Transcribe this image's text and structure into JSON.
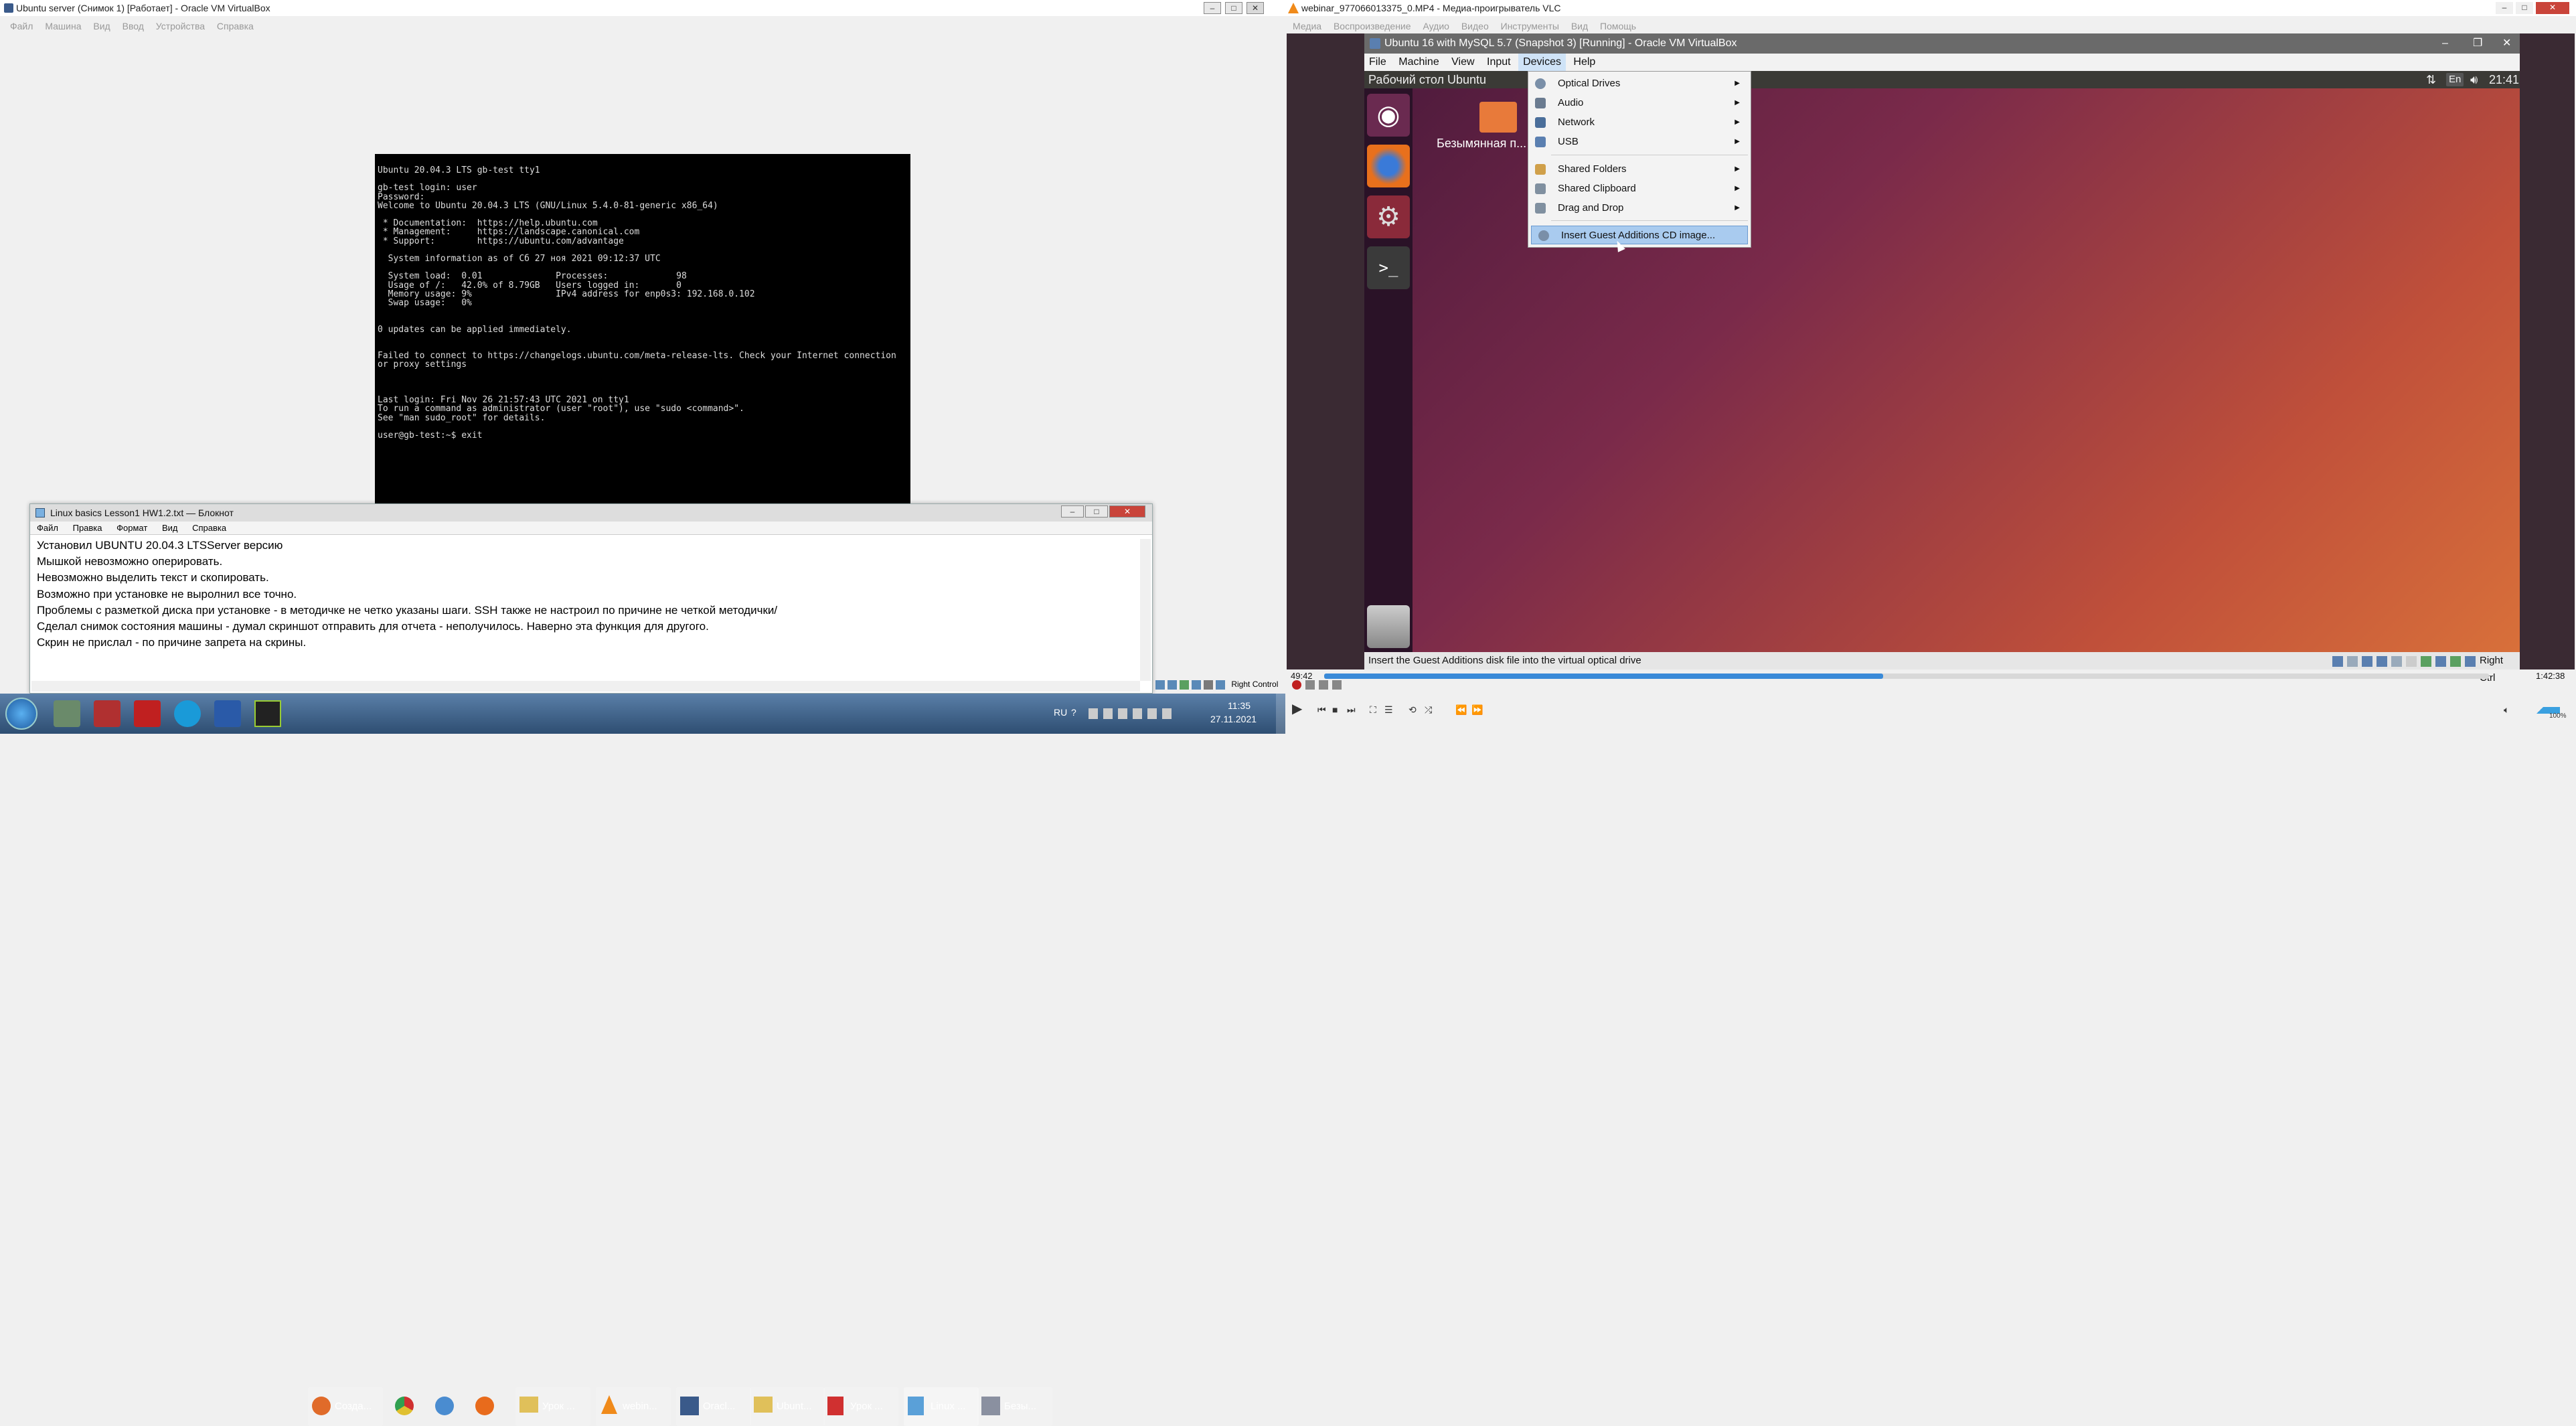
{
  "left_window": {
    "title": "Ubuntu server (Снимок 1) [Работает] - Oracle VM VirtualBox",
    "menu": [
      "Файл",
      "Машина",
      "Вид",
      "Ввод",
      "Устройства",
      "Справка"
    ],
    "status_right": "Right Control"
  },
  "terminal": {
    "lines": "Ubuntu 20.04.3 LTS gb-test tty1\n\ngb-test login: user\nPassword:\nWelcome to Ubuntu 20.04.3 LTS (GNU/Linux 5.4.0-81-generic x86_64)\n\n * Documentation:  https://help.ubuntu.com\n * Management:     https://landscape.canonical.com\n * Support:        https://ubuntu.com/advantage\n\n  System information as of Сб 27 ноя 2021 09:12:37 UTC\n\n  System load:  0.01              Processes:             98\n  Usage of /:   42.0% of 8.79GB   Users logged in:       0\n  Memory usage: 9%                IPv4 address for enp0s3: 192.168.0.102\n  Swap usage:   0%\n\n\n0 updates can be applied immediately.\n\n\nFailed to connect to https://changelogs.ubuntu.com/meta-release-lts. Check your Internet connection\nor proxy settings\n\n\n\nLast login: Fri Nov 26 21:57:43 UTC 2021 on tty1\nTo run a command as administrator (user \"root\"), use \"sudo <command>\".\nSee \"man sudo_root\" for details.\n\nuser@gb-test:~$ exit"
  },
  "notepad": {
    "title": "Linux basics Lesson1 HW1.2.txt — Блокнот",
    "menu": [
      "Файл",
      "Правка",
      "Формат",
      "Вид",
      "Справка"
    ],
    "lines": [
      "Установил UBUNTU 20.04.3 LTSServer версию",
      "Мышкой невозможно оперировать.",
      "Невозможно выделить текст и скопировать.",
      "Возможно при установке не выролнил все точно.",
      "Проблемы с разметкой диска при установке - в методичке не четко указаны шаги. SSH также не настроил по причине не четкой методички/",
      "Сделал снимок состояния машины - думал скриншот отправить для отчета - неполучилось. Наверно эта функция для другого.",
      "Скрин не прислал - по причине запрета на скрины."
    ]
  },
  "vlc": {
    "title": "webinar_977066013...",
    "title_full": "webinar_977066013375_0.MP4 - Медиа-проигрыватель VLC",
    "menu": [
      "Медиа",
      "Воспроизведение",
      "Аудио",
      "Видео",
      "Инструменты",
      "Вид",
      "Помощь"
    ],
    "time_elapsed": "49:42",
    "time_total": "1:42:38",
    "progress": 0.48,
    "volume": "100%"
  },
  "inner_vbox": {
    "title": "Ubuntu 16 with MySQL 5.7 (Snapshot 3) [Running] - Oracle VM VirtualBox",
    "menu": [
      "File",
      "Machine",
      "View",
      "Input",
      "Devices",
      "Help"
    ],
    "active_menu": "Devices",
    "status_text": "Insert the Guest Additions disk file into the virtual optical drive",
    "status_right": "Right Ctrl"
  },
  "ubuntu": {
    "topbar_title": "Рабочий стол Ubuntu",
    "lang": "En",
    "clock": "21:41",
    "desktop_folder": "Безымянная п..."
  },
  "devices_menu": {
    "items": [
      {
        "label": "Optical Drives",
        "submenu": true,
        "icon_color": "#7a8fa8"
      },
      {
        "label": "Audio",
        "submenu": true,
        "icon_color": "#6a7b90"
      },
      {
        "label": "Network",
        "submenu": true,
        "icon_color": "#4a6e9a"
      },
      {
        "label": "USB",
        "submenu": true,
        "icon_color": "#5a7fb0"
      },
      {
        "label": "Shared Folders",
        "submenu": true,
        "icon_color": "#d0a04a"
      },
      {
        "label": "Shared Clipboard",
        "submenu": true,
        "icon_color": "#8090a0"
      },
      {
        "label": "Drag and Drop",
        "submenu": true,
        "icon_color": "#8090a0"
      },
      {
        "label": "Insert Guest Additions CD image...",
        "submenu": false,
        "highlighted": true,
        "icon_color": "#7a8fa8"
      }
    ]
  },
  "taskbar": {
    "items": [
      {
        "label": "Созда...",
        "color": "#e06b2a"
      },
      {
        "label": "",
        "color": "#4a8cd0"
      },
      {
        "label": "",
        "color": "#e86b1c"
      },
      {
        "label": "Урок ...",
        "color": "#e0c05a"
      },
      {
        "label": "webin...",
        "color": "#f08a1a"
      },
      {
        "label": "Oracl...",
        "color": "#3a5a8a"
      },
      {
        "label": "Ubunt...",
        "color": "#e0c05a"
      },
      {
        "label": "Урок ...",
        "color": "#d03030"
      },
      {
        "label": "Linux ...",
        "color": "#5aa0d8"
      },
      {
        "label": "Безы...",
        "color": "#8a90a0"
      }
    ],
    "lang": "RU",
    "time": "11:35",
    "date": "27.11.2021"
  }
}
